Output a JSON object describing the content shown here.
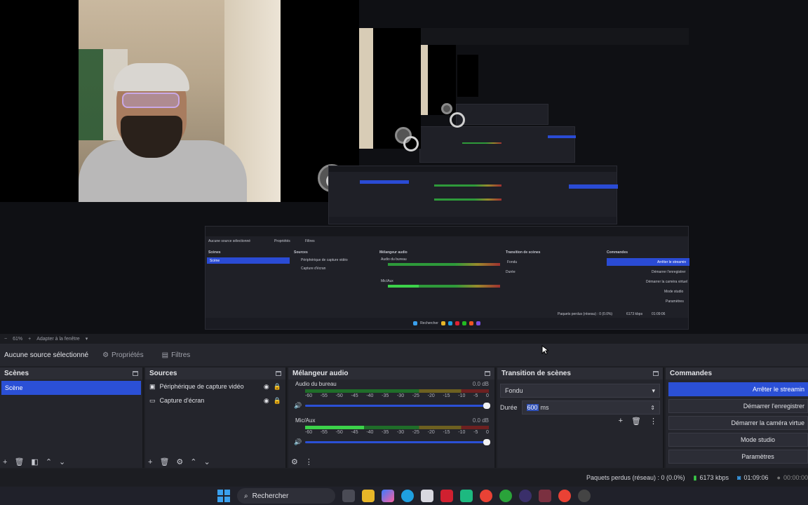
{
  "preview": {
    "zoom_level": "61%",
    "fit_label": "Adapter à la fenêtre",
    "nested": {
      "no_source": "Aucune source sélectionné",
      "properties": "Propriétés",
      "filters": "Filtres",
      "scenes": "Scènes",
      "scene": "Scène",
      "sources": "Sources",
      "source1": "Périphérique de capture vidéo",
      "source2": "Capture d'écran",
      "mixer": "Mélangeur audio",
      "ch1": "Audio du bureau",
      "ch2": "Mic/Aux",
      "transition": "Transition de scènes",
      "fade": "Fondu",
      "duration": "Durée",
      "controls": "Commandes",
      "stop": "Arrêter le streamin",
      "record": "Démarrer l'enregistrer",
      "vcam": "Démarrer la caméra virtuel",
      "studio": "Mode studio",
      "settings": "Paramètres",
      "search": "Rechercher",
      "dropped": "Paquets perdus (réseau) : 0 (0.0%)",
      "bitrate": "6173 kbps",
      "time": "01:09:06"
    }
  },
  "toolbar": {
    "no_source_label": "Aucune source sélectionné",
    "properties_label": "Propriétés",
    "filters_label": "Filtres"
  },
  "scenes_dock": {
    "title": "Scènes",
    "items": [
      {
        "label": "Scène"
      }
    ]
  },
  "sources_dock": {
    "title": "Sources",
    "items": [
      {
        "label": "Périphérique de capture vidéo"
      },
      {
        "label": "Capture d'écran"
      }
    ]
  },
  "mixer_dock": {
    "title": "Mélangeur audio",
    "ticks": [
      "-60",
      "-55",
      "-50",
      "-45",
      "-40",
      "-35",
      "-30",
      "-25",
      "-20",
      "-15",
      "-10",
      "-5",
      "0"
    ],
    "channels": [
      {
        "name": "Audio du bureau",
        "db": "0.0 dB",
        "level": 0.0
      },
      {
        "name": "Mic/Aux",
        "db": "0.0 dB",
        "level": 0.32
      }
    ]
  },
  "transition_dock": {
    "title": "Transition de scènes",
    "transition": "Fondu",
    "duration_label": "Durée",
    "duration_value": "600",
    "duration_unit": "ms"
  },
  "controls_dock": {
    "title": "Commandes",
    "buttons": [
      {
        "label": "Arrêter le streamin"
      },
      {
        "label": "Démarrer l'enregistrer"
      },
      {
        "label": "Démarrer la caméra virtue"
      },
      {
        "label": "Mode studio"
      },
      {
        "label": "Paramètres"
      }
    ]
  },
  "status": {
    "dropped_frames": "Paquets perdus (réseau) : 0 (0.0%)",
    "bitrate": "6173 kbps",
    "stream_time": "01:09:06",
    "record_time": "00:00:00"
  },
  "taskbar": {
    "search_label": "Rechercher"
  },
  "colors": {
    "accent": "#2b50d6",
    "panel": "#24252c",
    "meter_green": "#3cd24a"
  }
}
